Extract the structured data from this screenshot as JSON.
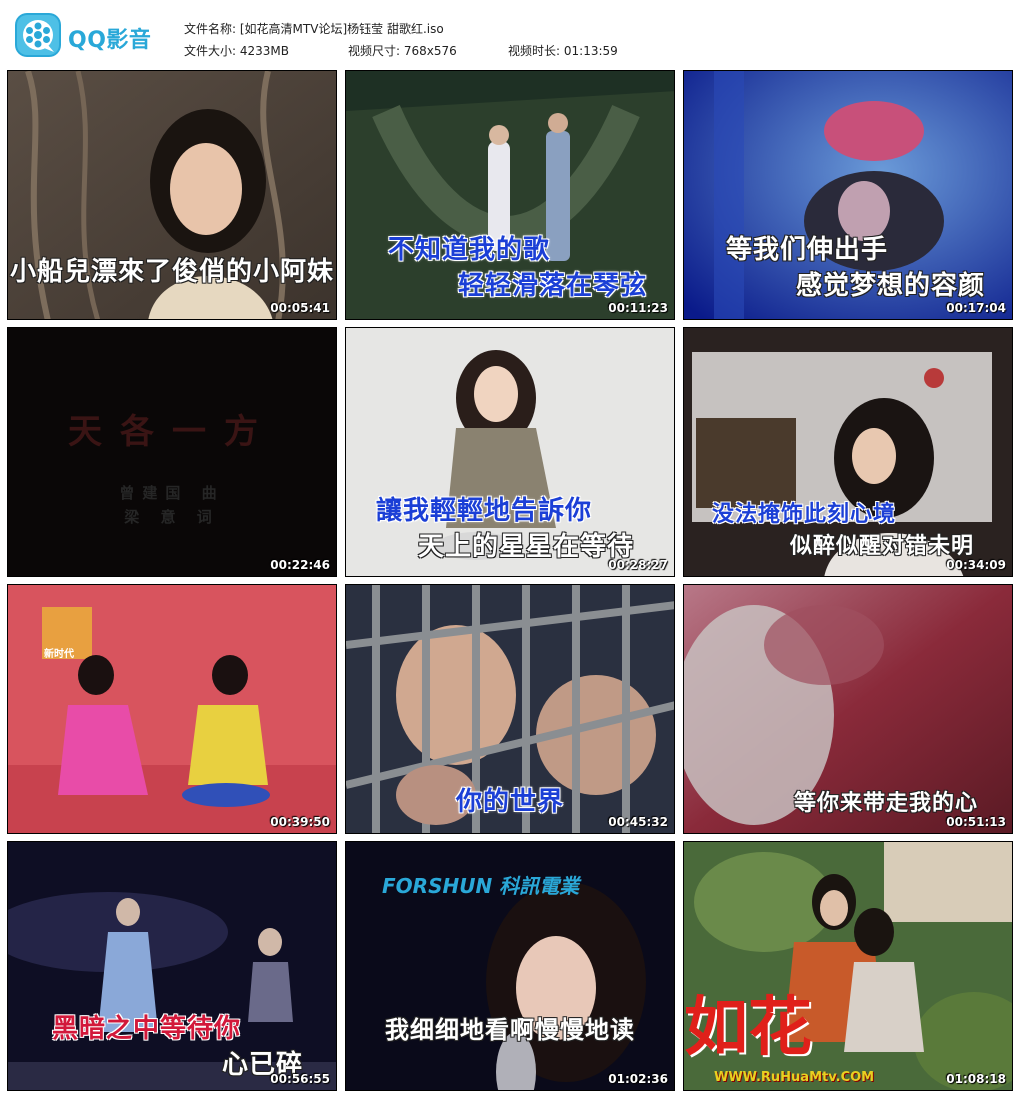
{
  "app": {
    "name": "QQ影音",
    "brand_color": "#29a8d8"
  },
  "file_info": {
    "name_label": "文件名称:",
    "name_value": "[如花高清MTV论坛]杨钰莹 甜歌红.iso",
    "size_label": "文件大小:",
    "size_value": "4233MB",
    "dims_label": "视频尺寸:",
    "dims_value": "768x576",
    "duration_label": "视频时长:",
    "duration_value": "01:13:59"
  },
  "thumbnails": [
    {
      "timestamp": "00:05:41",
      "caption_lines": [
        "小船兒漂來了俊俏的小阿妹"
      ],
      "caption_style": "white"
    },
    {
      "timestamp": "00:11:23",
      "caption_lines": [
        "不知道我的歌",
        "轻轻滑落在琴弦"
      ],
      "caption_style": "blue"
    },
    {
      "timestamp": "00:17:04",
      "caption_lines": [
        "等我们伸出手",
        "感觉梦想的容颜"
      ],
      "caption_style": "white"
    },
    {
      "timestamp": "00:22:46",
      "caption_lines": [
        "天各一方",
        "曾建国 曲",
        "梁 意 词"
      ],
      "caption_style": "dark"
    },
    {
      "timestamp": "00:28:27",
      "caption_lines": [
        "讓我輕輕地告訴你",
        "天上的星星在等待"
      ],
      "caption_style": "blue"
    },
    {
      "timestamp": "00:34:09",
      "caption_lines": [
        "没法掩饰此刻心境",
        "似醉似醒对错未明"
      ],
      "caption_style": "white"
    },
    {
      "timestamp": "00:39:50",
      "caption_lines": [],
      "caption_style": "none",
      "logo_text": "新时代"
    },
    {
      "timestamp": "00:45:32",
      "caption_lines": [
        "你的世界"
      ],
      "caption_style": "blue"
    },
    {
      "timestamp": "00:51:13",
      "caption_lines": [
        "等你来带走我的心"
      ],
      "caption_style": "white"
    },
    {
      "timestamp": "00:56:55",
      "caption_lines": [
        "黑暗之中等待你",
        "心已碎"
      ],
      "caption_style": "red"
    },
    {
      "timestamp": "01:02:36",
      "caption_lines": [
        "我细细地看啊慢慢地读"
      ],
      "caption_style": "white",
      "logo_text": "FORSHUN 科訊電業"
    },
    {
      "timestamp": "01:08:18",
      "caption_lines": [],
      "caption_style": "none",
      "watermark_text": "如花",
      "watermark_url": "WWW.RuHuaMtv.COM"
    }
  ]
}
